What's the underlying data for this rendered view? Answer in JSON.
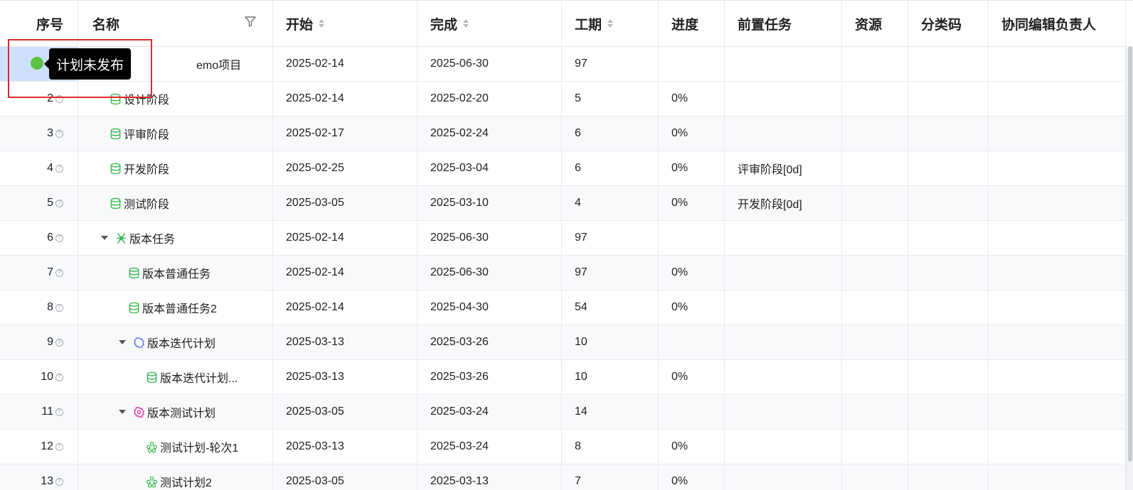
{
  "columns": {
    "index": "序号",
    "name": "名称",
    "start": "开始",
    "end": "完成",
    "duration": "工期",
    "progress": "进度",
    "predecessor": "前置任务",
    "resource": "资源",
    "category_code": "分类码",
    "owner": "协同编辑负责人"
  },
  "tooltip": "计划未发布",
  "status_color": "#5ec242",
  "rows": [
    {
      "idx": "",
      "name": "emo项目",
      "start": "2025-02-14",
      "end": "2025-06-30",
      "dur": "97",
      "prog": "",
      "pred": ""
    },
    {
      "idx": "2",
      "name": "设计阶段",
      "start": "2025-02-14",
      "end": "2025-02-20",
      "dur": "5",
      "prog": "0%",
      "pred": ""
    },
    {
      "idx": "3",
      "name": "评审阶段",
      "start": "2025-02-17",
      "end": "2025-02-24",
      "dur": "6",
      "prog": "0%",
      "pred": ""
    },
    {
      "idx": "4",
      "name": "开发阶段",
      "start": "2025-02-25",
      "end": "2025-03-04",
      "dur": "6",
      "prog": "0%",
      "pred": "评审阶段[0d]"
    },
    {
      "idx": "5",
      "name": "测试阶段",
      "start": "2025-03-05",
      "end": "2025-03-10",
      "dur": "4",
      "prog": "0%",
      "pred": "开发阶段[0d]"
    },
    {
      "idx": "6",
      "name": "版本任务",
      "start": "2025-02-14",
      "end": "2025-06-30",
      "dur": "97",
      "prog": "",
      "pred": ""
    },
    {
      "idx": "7",
      "name": "版本普通任务",
      "start": "2025-02-14",
      "end": "2025-06-30",
      "dur": "97",
      "prog": "0%",
      "pred": ""
    },
    {
      "idx": "8",
      "name": "版本普通任务2",
      "start": "2025-02-14",
      "end": "2025-04-30",
      "dur": "54",
      "prog": "0%",
      "pred": ""
    },
    {
      "idx": "9",
      "name": "版本迭代计划",
      "start": "2025-03-13",
      "end": "2025-03-26",
      "dur": "10",
      "prog": "",
      "pred": ""
    },
    {
      "idx": "10",
      "name": "版本迭代计划...",
      "start": "2025-03-13",
      "end": "2025-03-26",
      "dur": "10",
      "prog": "0%",
      "pred": ""
    },
    {
      "idx": "11",
      "name": "版本测试计划",
      "start": "2025-03-05",
      "end": "2025-03-24",
      "dur": "14",
      "prog": "",
      "pred": ""
    },
    {
      "idx": "12",
      "name": "测试计划-轮次1",
      "start": "2025-03-13",
      "end": "2025-03-24",
      "dur": "8",
      "prog": "0%",
      "pred": ""
    },
    {
      "idx": "13",
      "name": "测试计划2",
      "start": "2025-03-05",
      "end": "2025-03-13",
      "dur": "7",
      "prog": "0%",
      "pred": ""
    }
  ],
  "icons": {
    "filter": "filter-icon",
    "stack": "database-stack-icon",
    "version": "version-icon",
    "iteration": "iteration-gear-icon",
    "test_plan": "test-plan-icon",
    "test_round": "test-round-icon"
  }
}
